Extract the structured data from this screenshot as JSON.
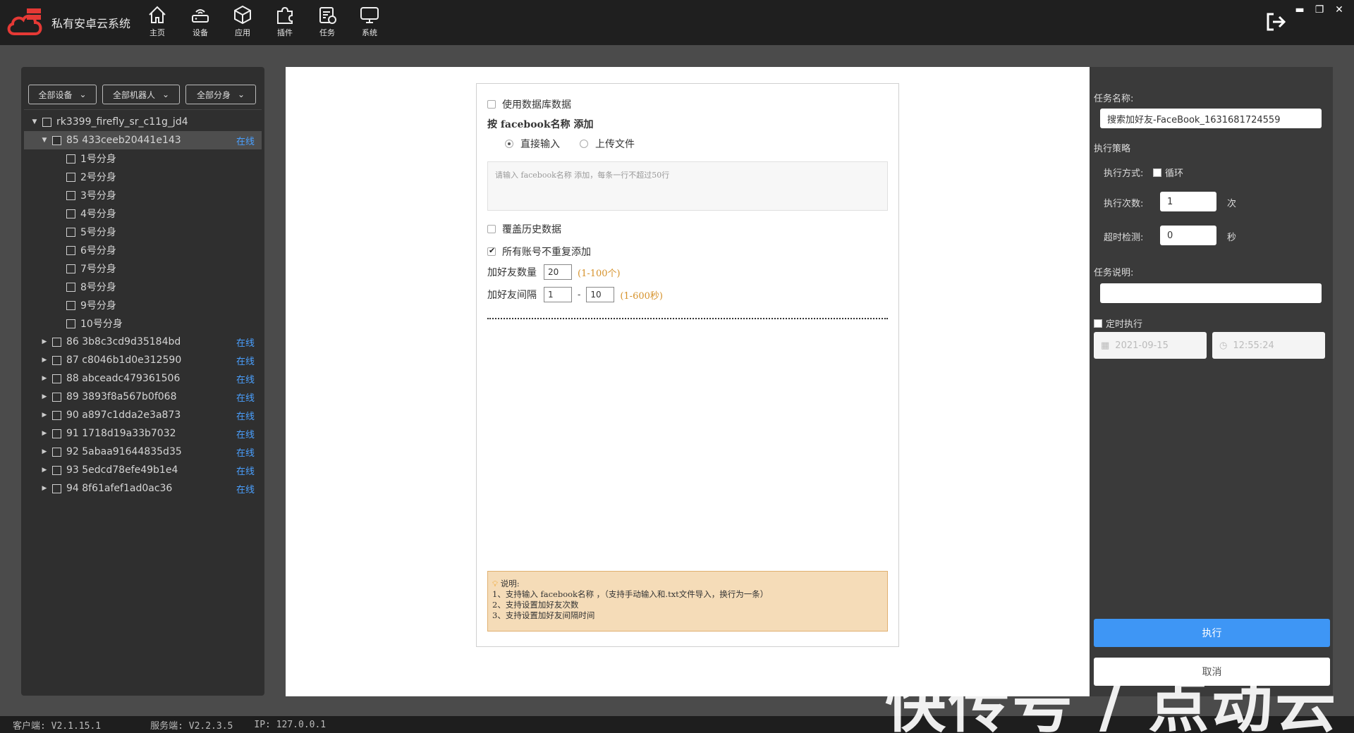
{
  "app": {
    "title": "私有安卓云系统",
    "brand_color": "#e53935",
    "accent": "#3e96f5"
  },
  "nav": [
    {
      "label": "主页",
      "icon": "home-icon"
    },
    {
      "label": "设备",
      "icon": "router-icon"
    },
    {
      "label": "应用",
      "icon": "cube-icon"
    },
    {
      "label": "插件",
      "icon": "puzzle-icon"
    },
    {
      "label": "任务",
      "icon": "task-icon"
    },
    {
      "label": "系统",
      "icon": "monitor-icon"
    }
  ],
  "window": {
    "minimize": "▬",
    "restore": "❐",
    "close": "✕"
  },
  "filters": {
    "devices": "全部设备",
    "robots": "全部机器人",
    "clones": "全部分身"
  },
  "tree": {
    "root": "rk3399_firefly_sr_c11g_jd4",
    "expanded": {
      "name": "85 433ceeb20441e143",
      "status": "在线"
    },
    "clones": [
      "1号分身",
      "2号分身",
      "3号分身",
      "4号分身",
      "5号分身",
      "6号分身",
      "7号分身",
      "8号分身",
      "9号分身",
      "10号分身"
    ],
    "devices": [
      {
        "name": "86 3b8c3cd9d35184bd",
        "status": "在线"
      },
      {
        "name": "87 c8046b1d0e312590",
        "status": "在线"
      },
      {
        "name": "88 abceadc479361506",
        "status": "在线"
      },
      {
        "name": "89 3893f8a567b0f068",
        "status": "在线"
      },
      {
        "name": "90 a897c1dda2e3a873",
        "status": "在线"
      },
      {
        "name": "91 1718d19a33b7032",
        "status": "在线"
      },
      {
        "name": "92 5abaa91644835d35",
        "status": "在线"
      },
      {
        "name": "93 5edcd78efe49b1e4",
        "status": "在线"
      },
      {
        "name": "94 8f61afef1ad0ac36",
        "status": "在线"
      }
    ]
  },
  "form": {
    "use_db": "使用数据库数据",
    "section_title": "按 facebook名称 添加",
    "radio_direct": "直接输入",
    "radio_upload": "上传文件",
    "textarea_placeholder": "请输入 facebook名称 添加，每条一行不超过50行",
    "overwrite": "覆盖历史数据",
    "no_duplicate": "所有账号不重复添加",
    "friend_count_label": "加好友数量",
    "friend_count_value": "20",
    "friend_count_hint": "(1-100个)",
    "interval_label": "加好友间隔",
    "interval_min": "1",
    "interval_sep": "-",
    "interval_max": "10",
    "interval_hint": "(1-600秒)",
    "note_title": "说明:",
    "note_lines": [
      "1、支持输入 facebook名称 ，（支持手动输入和.txt文件导入，换行为一条）",
      "2、支持设置加好友次数",
      "3、支持设置加好友间隔时间"
    ]
  },
  "right": {
    "task_name_label": "任务名称:",
    "task_name_value": "搜索加好友-FaceBook_1631681724559",
    "strategy_label": "执行策略",
    "exec_mode_label": "执行方式:",
    "loop_label": "循环",
    "exec_count_label": "执行次数:",
    "exec_count_value": "1",
    "exec_count_unit": "次",
    "timeout_label": "超时检测:",
    "timeout_value": "0",
    "timeout_unit": "秒",
    "desc_label": "任务说明:",
    "schedule_label": "定时执行",
    "date": "2021-09-15",
    "time": "12:55:24",
    "execute": "执行",
    "cancel": "取消"
  },
  "statusbar": {
    "client": "客户端: V2.1.15.1",
    "server": "服务端: V2.2.3.5",
    "ip": "IP: 127.0.0.1"
  },
  "watermark": "快传号 / 点动云"
}
